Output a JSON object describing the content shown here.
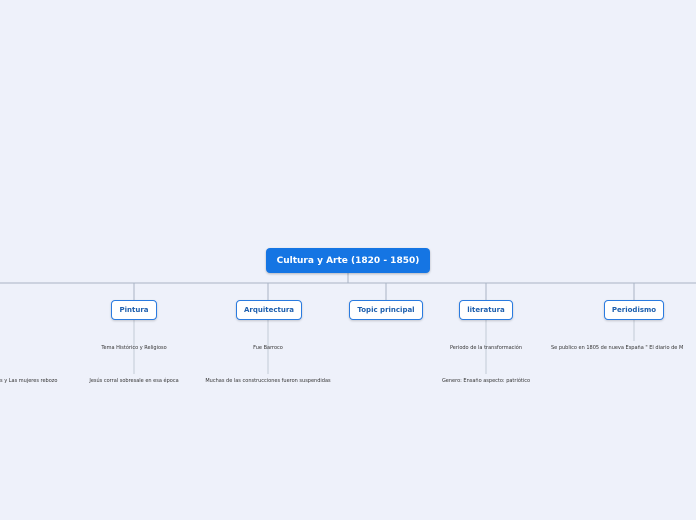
{
  "root": {
    "label": "Cultura y Arte (1820 - 1850)"
  },
  "topics": [
    {
      "label": "Pintura",
      "notes": [
        "Tema Histórico y Religioso",
        "Jesús corral sobresale en esa época"
      ]
    },
    {
      "label": "Arquitectura",
      "notes": [
        "Fue Barroco",
        "Muchas de las construcciones fueron suspendidas"
      ]
    },
    {
      "label": "Topic principal",
      "notes": []
    },
    {
      "label": "literatura",
      "notes": [
        "Periodo de la transformación",
        "Genero: Ensaño  aspecto: patriótico"
      ]
    },
    {
      "label": "Periodismo",
      "notes": [
        "Se publico en 1805 de nueva España  \" El diario de M"
      ]
    }
  ],
  "offscreen_left_note": "s y Las mujeres rebozo",
  "colors": {
    "background": "#eef1fa",
    "root_fill": "#1575e3",
    "topic_border": "#2a7be0",
    "connector": "#a9b4c4"
  }
}
